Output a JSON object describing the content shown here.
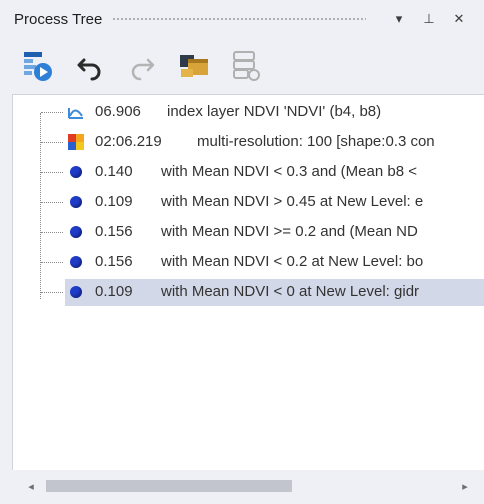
{
  "panel": {
    "title": "Process Tree",
    "controls": {
      "dropdown_glyph": "▾",
      "pin_glyph": "⊥",
      "close_glyph": "✕"
    }
  },
  "toolbar": {
    "icons": [
      "execute-process-icon",
      "undo-icon",
      "redo-icon",
      "load-rule-set-icon",
      "save-rule-set-icon"
    ]
  },
  "tree": {
    "rows": [
      {
        "time": "06.906",
        "desc": "index layer NDVI 'NDVI' (b4, b8)",
        "icon": "layer-arithmetic-icon"
      },
      {
        "time": "02:06.219",
        "desc": "multi-resolution: 100 [shape:0.3 con",
        "icon": "multiresolution-segmentation-icon"
      },
      {
        "time": "0.140",
        "desc": "with Mean NDVI < 0.3  and (Mean b8 <",
        "icon": "classification-dot-icon"
      },
      {
        "time": "0.109",
        "desc": "with Mean NDVI > 0.45  at New Level: e",
        "icon": "classification-dot-icon"
      },
      {
        "time": "0.156",
        "desc": "with Mean NDVI >= 0.2  and (Mean ND",
        "icon": "classification-dot-icon"
      },
      {
        "time": "0.156",
        "desc": "with Mean NDVI < 0.2  at New Level: bo",
        "icon": "classification-dot-icon"
      },
      {
        "time": "0.109",
        "desc": "with Mean NDVI < 0  at New Level: gidr",
        "icon": "classification-dot-icon"
      }
    ],
    "selected_index": 6
  },
  "scrollbar": {
    "left_glyph": "◂",
    "right_glyph": "▸"
  },
  "colors": {
    "dot_blue": "#1e3cc8",
    "selection": "#d3d8e8"
  }
}
